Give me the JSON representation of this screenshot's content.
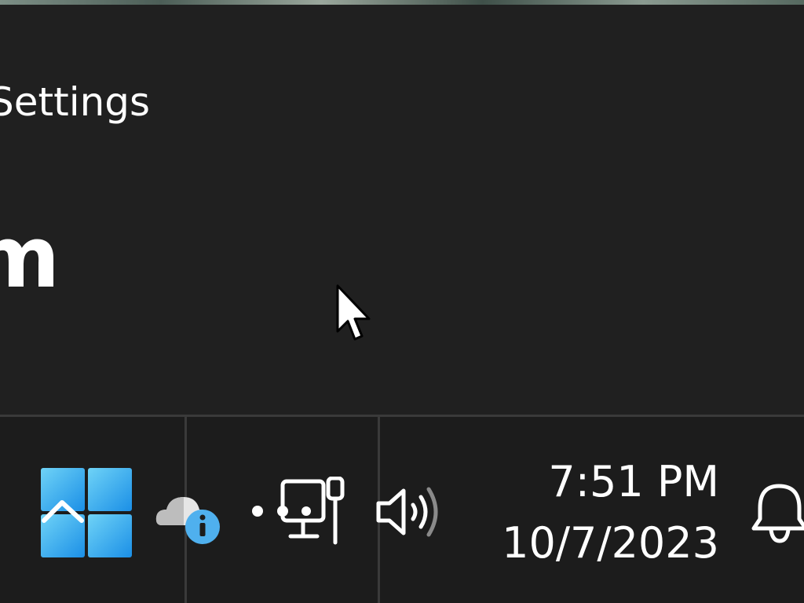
{
  "window": {
    "title": "Settings",
    "heading": "m"
  },
  "taskbar": {
    "start_icon": "windows-logo-icon",
    "tray_icons": [
      "onedrive-info-icon",
      "network-icon",
      "volume-icon",
      "notification-bell-icon"
    ],
    "clock": {
      "time": "7:51 PM",
      "date": "10/7/2023"
    }
  },
  "colors": {
    "window_bg": "#202020",
    "taskbar_bg": "#1c1c1c",
    "divider": "#3a3a3a",
    "accent_blue": "#3aa0e8",
    "text": "#ffffff"
  }
}
